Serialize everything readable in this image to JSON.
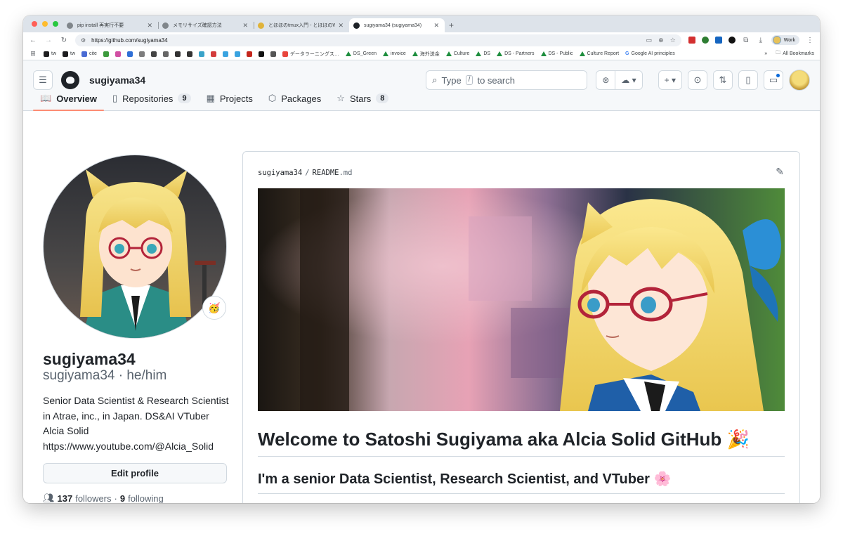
{
  "browser": {
    "tabs": [
      {
        "title": "pip install 再実行不要",
        "icon": "chatgpt-icon",
        "active": false
      },
      {
        "title": "メモリサイズ確認方法",
        "icon": "chatgpt-icon",
        "active": false
      },
      {
        "title": "とほほのtmux入門 - とほほのW…",
        "icon": "tohoho-icon",
        "active": false
      },
      {
        "title": "sugiyama34 (sugiyama34)",
        "icon": "github-icon",
        "active": true
      }
    ],
    "url": "https://github.com/sugiyama34",
    "profile_label": "Work",
    "bookmarks": [
      {
        "label": "tw",
        "color": "#1d1d1f"
      },
      {
        "label": "tw",
        "color": "#1d1d1f"
      },
      {
        "label": "cite",
        "color": "#4a6bd3"
      },
      {
        "label": "",
        "color": "#3c9a3c"
      },
      {
        "label": "",
        "color": "#d14fa3"
      },
      {
        "label": "",
        "color": "#2f6fd6"
      },
      {
        "label": "",
        "color": "#7d7d7d"
      },
      {
        "label": "",
        "color": "#444444"
      },
      {
        "label": "",
        "color": "#666666"
      },
      {
        "label": "",
        "color": "#333333"
      },
      {
        "label": "",
        "color": "#333333"
      },
      {
        "label": "",
        "color": "#3aa3c9"
      },
      {
        "label": "",
        "color": "#d33c3c"
      },
      {
        "label": "",
        "color": "#3aa3e0"
      },
      {
        "label": "",
        "color": "#3aa3e0"
      },
      {
        "label": "",
        "color": "#c4261d"
      },
      {
        "label": "",
        "color": "#111111"
      },
      {
        "label": "",
        "color": "#555555"
      },
      {
        "label": "データラーニングス…",
        "color": "#e8453c"
      }
    ],
    "drive_bookmarks": [
      "DS_Green",
      "invoice",
      "海外送金",
      "Culture",
      "DS",
      "DS - Partners",
      "DS - Public",
      "Culture Report"
    ],
    "google_bookmark": "Google AI principles",
    "all_bookmarks": "All Bookmarks"
  },
  "github": {
    "username": "sugiyama34",
    "search_prefix": "Type",
    "search_key": "/",
    "search_suffix": "to search",
    "nav": [
      {
        "label": "Overview",
        "icon": "book-icon",
        "count": null
      },
      {
        "label": "Repositories",
        "icon": "repo-icon",
        "count": "9"
      },
      {
        "label": "Projects",
        "icon": "table-icon",
        "count": null
      },
      {
        "label": "Packages",
        "icon": "package-icon",
        "count": null
      },
      {
        "label": "Stars",
        "icon": "star-icon",
        "count": "8"
      }
    ]
  },
  "profile": {
    "name": "sugiyama34",
    "login": "sugiyama34",
    "pronouns": "he/him",
    "status_emoji": "🥳",
    "bio": "Senior Data Scientist & Research Scientist in Atrae, inc., in Japan. DS&AI VTuber Alcia Solid https://www.youtube.com/@Alcia_Solid",
    "edit_label": "Edit profile",
    "followers_count": "137",
    "followers_label": "followers",
    "following_count": "9",
    "following_label": "following"
  },
  "readme": {
    "owner": "sugiyama34",
    "file": "README",
    "ext": ".md",
    "h1": "Welcome to Satoshi Sugiyama aka Alcia Solid GitHub 🎉",
    "h2": "I'm a senior Data Scientist, Research Scientist, and VTuber 🌸"
  },
  "colors": {
    "accent_tab_underline": "#fd8c73",
    "notification_dot": "#0969da"
  }
}
